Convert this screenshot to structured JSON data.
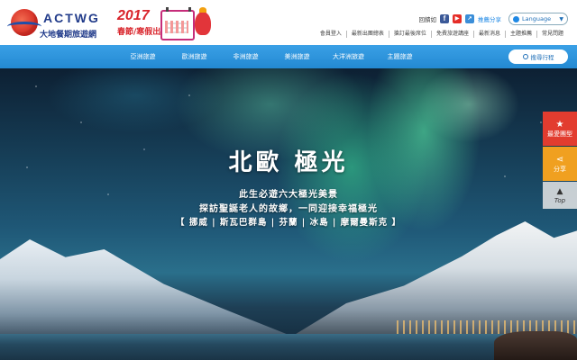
{
  "logo": {
    "brand": "ACTWG",
    "sub": "大地餐期旅遊網"
  },
  "promo": {
    "year": "2017",
    "title": "春節/寒假出團表"
  },
  "header": {
    "reply_label": "回饋如",
    "share_label": "推薦分享",
    "language_label": "Language",
    "links": [
      "會員登入",
      "最新出團總表",
      "搶訂最後席位",
      "免費旅遊講座",
      "最新消息",
      "主題推薦",
      "常見問題"
    ]
  },
  "nav": {
    "items": [
      "亞洲旅遊",
      "歐洲旅遊",
      "非洲旅遊",
      "美洲旅遊",
      "大洋洲旅遊",
      "主題旅遊"
    ],
    "search_trip_label": "搜尋行程"
  },
  "hero": {
    "title": "北歐 極光",
    "line1": "此生必遊六大極光美景",
    "line2": "探訪聖誕老人的故鄉，一同迎接幸福極光",
    "line3": "【 挪威 | 斯瓦巴群島 | 芬蘭 | 冰島 | 摩爾曼斯克 】"
  },
  "side": {
    "favorite_label": "最愛團型",
    "share_label": "分享",
    "top_label": "Top"
  },
  "colors": {
    "nav": "#2389d2",
    "favorite": "#e23c2f",
    "share": "#f0a020",
    "brand": "#213b8a"
  }
}
